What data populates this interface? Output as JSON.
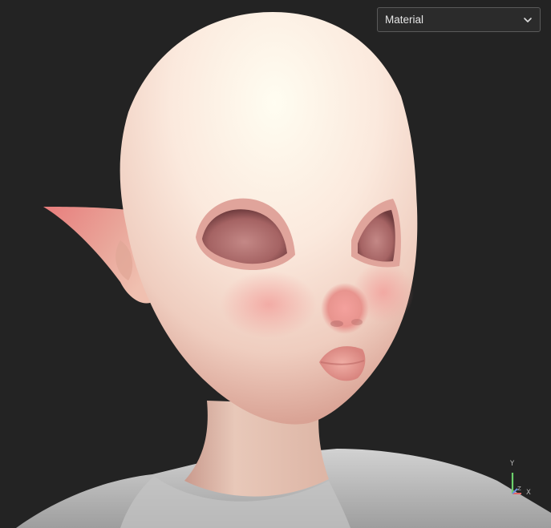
{
  "viewport": {
    "shading_mode": {
      "selected": "Material",
      "icon": "chevron-down-icon"
    },
    "axis_gizmo": {
      "y_label": "Y",
      "x_label": "X",
      "z_label": "Z",
      "colors": {
        "y": "#6bd06b",
        "x": "#e06767",
        "z": "#6b8fe0"
      }
    },
    "background_color": "#232323"
  }
}
